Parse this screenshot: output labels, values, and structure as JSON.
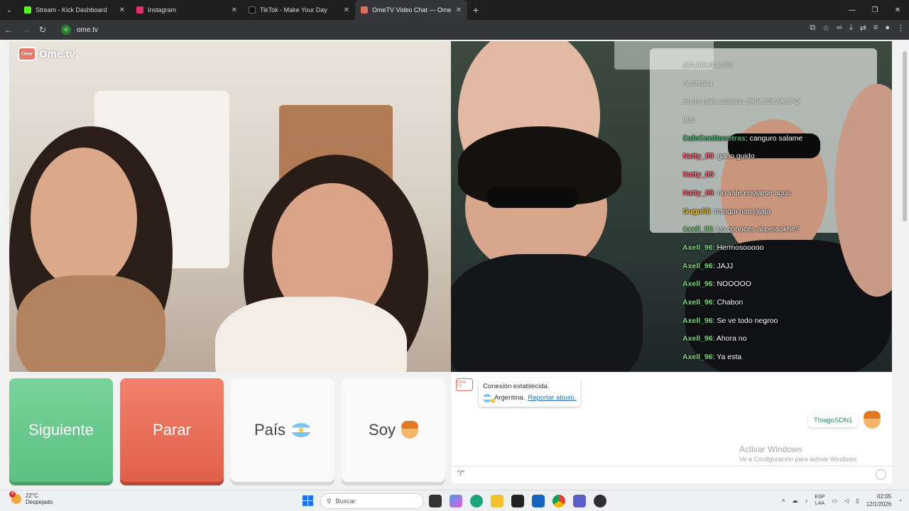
{
  "browser": {
    "tabs": [
      {
        "title": "Stream - Kick Dashboard",
        "color": "#53fc18"
      },
      {
        "title": "Instagram",
        "color": "#e1306c"
      },
      {
        "title": "TikTok - Make Your Day",
        "color": "#111111"
      },
      {
        "title": "OmeTV Video Chat — Ome",
        "color": "#e06a5a"
      }
    ],
    "url": "ome.tv"
  },
  "video": {
    "brand": "Ome.tv",
    "chat": [
      {
        "user": "",
        "text": "JJAJJAJA LOS",
        "faded": true
      },
      {
        "user": "",
        "text": "JAJAJAJ",
        "faded": true
      },
      {
        "user": "",
        "text": "es un pais asiatico JAJAJJAJAJJ Q",
        "faded": true
      },
      {
        "user": "",
        "text": "Ldp",
        "faded": true
      },
      {
        "user": "CafeConNosotras",
        "text": "canguro salame",
        "color": "#3fbf6b"
      },
      {
        "user": "Natty_85",
        "text": "gano guido",
        "color": "#ff6b7a"
      },
      {
        "user": "Natty_85",
        "text": "",
        "color": "#ff6b7a"
      },
      {
        "user": "Natty_85",
        "text": "no vale enojarse agus",
        "color": "#ff6b7a"
      },
      {
        "user": "Gugulili",
        "text": "tranqui nati jajaja",
        "color": "#f4d03f"
      },
      {
        "user": "Axell_96",
        "text": "Lo conoces al pelaokhe?",
        "color": "#7dd87d"
      },
      {
        "user": "Axell_96",
        "text": "Hermosooooo",
        "color": "#7dd87d"
      },
      {
        "user": "Axell_96",
        "text": "JAJJ",
        "color": "#7dd87d"
      },
      {
        "user": "Axell_96",
        "text": "NOOOOO",
        "color": "#7dd87d"
      },
      {
        "user": "Axell_96",
        "text": "Chabon",
        "color": "#7dd87d"
      },
      {
        "user": "Axell_96",
        "text": "Se ve todo negroo",
        "color": "#7dd87d"
      },
      {
        "user": "Axell_96",
        "text": "Ahora no",
        "color": "#7dd87d"
      },
      {
        "user": "Axell_96",
        "text": "Ya esta",
        "color": "#7dd87d"
      }
    ]
  },
  "controls": {
    "next": "Siguiente",
    "stop": "Parar",
    "country": "País",
    "me": "Soy"
  },
  "textchat": {
    "system_icon": "Ome TV",
    "connected": "Conexión establecida.",
    "country": "Argentina.",
    "report": "Reportar abuso.",
    "self_name": "ThiagoSDN1",
    "input_value": "\"/\"",
    "watermark_title": "Activar Windows",
    "watermark_sub": "Ve a Configuración para activar Windows."
  },
  "taskbar": {
    "temp": "22°C",
    "weather": "Despejado",
    "search": "Buscar",
    "lang1": "ESP",
    "lang2": "LAA",
    "time": "02:05",
    "date": "12/1/2026"
  }
}
